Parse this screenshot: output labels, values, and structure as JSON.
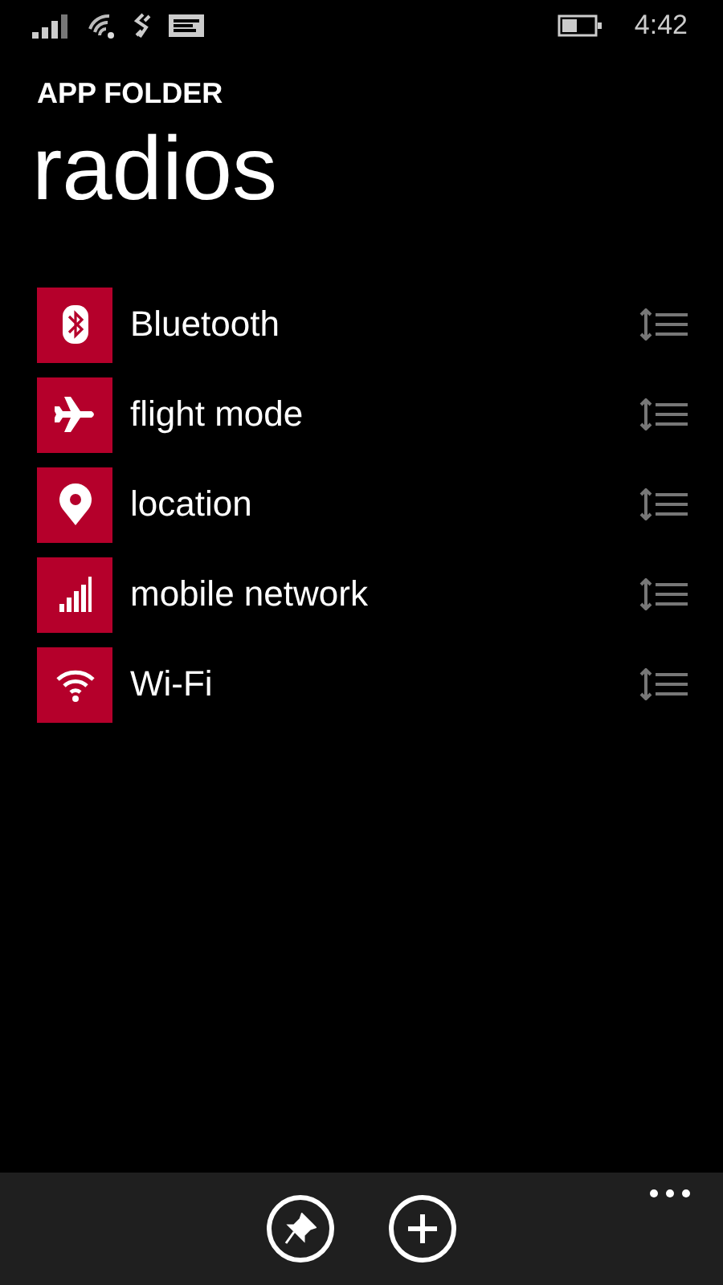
{
  "status_bar": {
    "time": "4:42"
  },
  "header": {
    "subtitle": "APP FOLDER",
    "title": "radios"
  },
  "items": [
    {
      "kind": "bluetooth",
      "label": "Bluetooth"
    },
    {
      "kind": "airplane",
      "label": "flight mode"
    },
    {
      "kind": "location",
      "label": "location"
    },
    {
      "kind": "signal",
      "label": "mobile network"
    },
    {
      "kind": "wifi",
      "label": "Wi-Fi"
    }
  ],
  "app_bar": {
    "buttons": [
      {
        "kind": "pin"
      },
      {
        "kind": "add"
      }
    ]
  }
}
